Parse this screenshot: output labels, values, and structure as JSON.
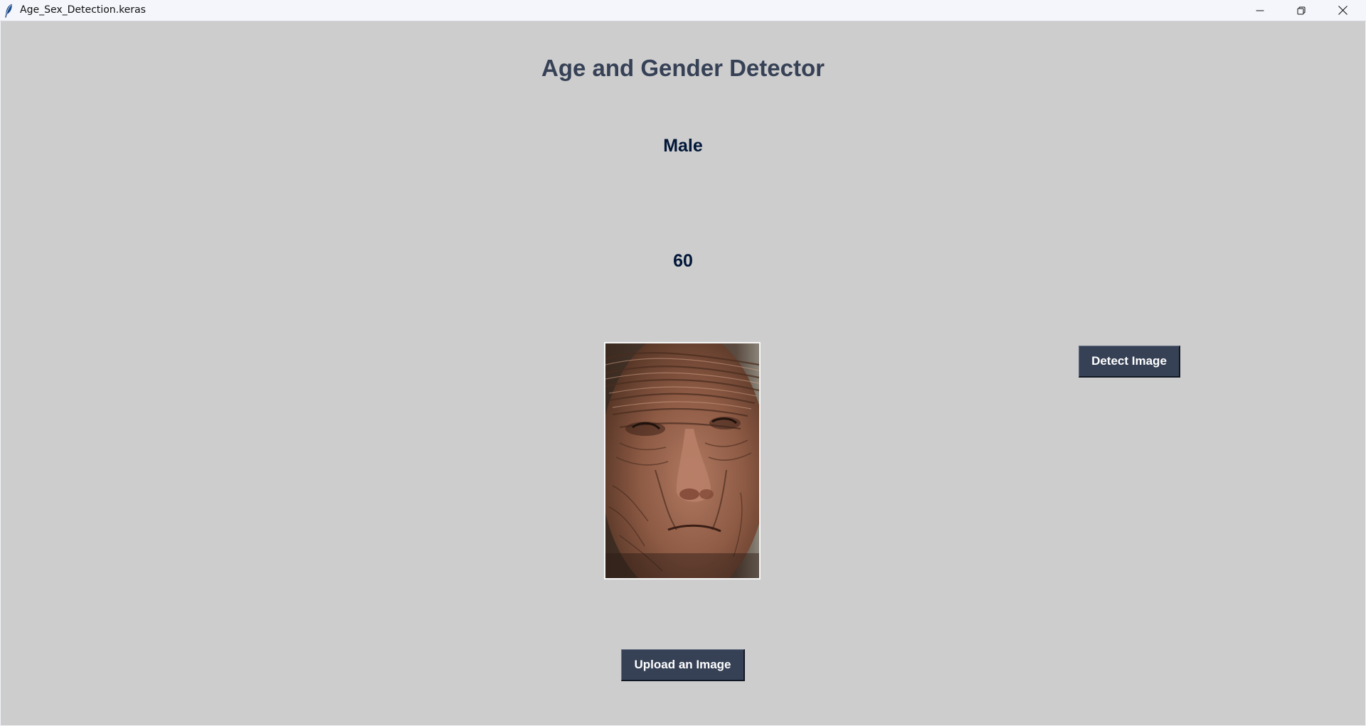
{
  "window": {
    "title": "Age_Sex_Detection.keras",
    "controls": {
      "minimize_icon": "minimize-icon",
      "restore_icon": "restore-icon",
      "close_icon": "close-icon"
    }
  },
  "app": {
    "heading": "Age and Gender Detector",
    "gender_result": "Male",
    "age_result": "60",
    "detect_button_label": "Detect Image",
    "upload_button_label": "Upload an Image",
    "uploaded_image": "elderly man face photograph"
  },
  "colors": {
    "background": "#cdcdcd",
    "heading": "#364156",
    "result_text": "#011638",
    "button_bg": "#364156",
    "button_text": "#ffffff"
  }
}
